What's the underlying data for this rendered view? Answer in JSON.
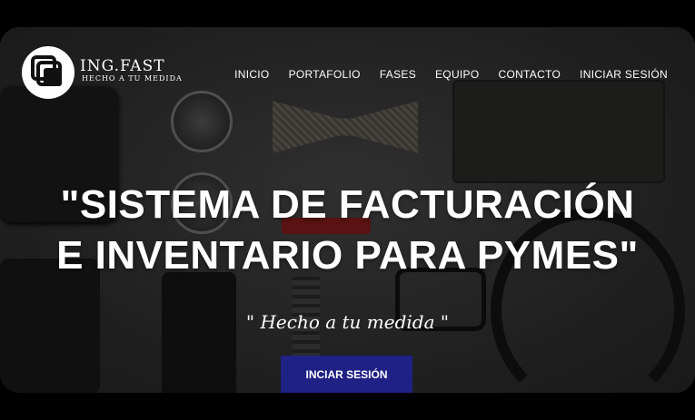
{
  "brand": {
    "name": "ING.FAST",
    "tagline": "HECHO A TU MEDIDA",
    "logo_icon": "stacked-squares-logo-icon"
  },
  "nav": {
    "items": [
      {
        "label": "INICIO"
      },
      {
        "label": "PORTAFOLIO"
      },
      {
        "label": "FASES"
      },
      {
        "label": "EQUIPO"
      },
      {
        "label": "CONTACTO"
      },
      {
        "label": "INICIAR SESIÓN"
      }
    ]
  },
  "hero": {
    "headline_line1": "\"SISTEMA DE FACTURACIÓN",
    "headline_line2": "E INVENTARIO PARA PYMES\"",
    "subtitle": "\" Hecho a tu medida \"",
    "cta_label": "INCIAR SESIÓN"
  },
  "colors": {
    "cta_background": "#1f2185",
    "text": "#ffffff",
    "page_background": "#000000"
  }
}
